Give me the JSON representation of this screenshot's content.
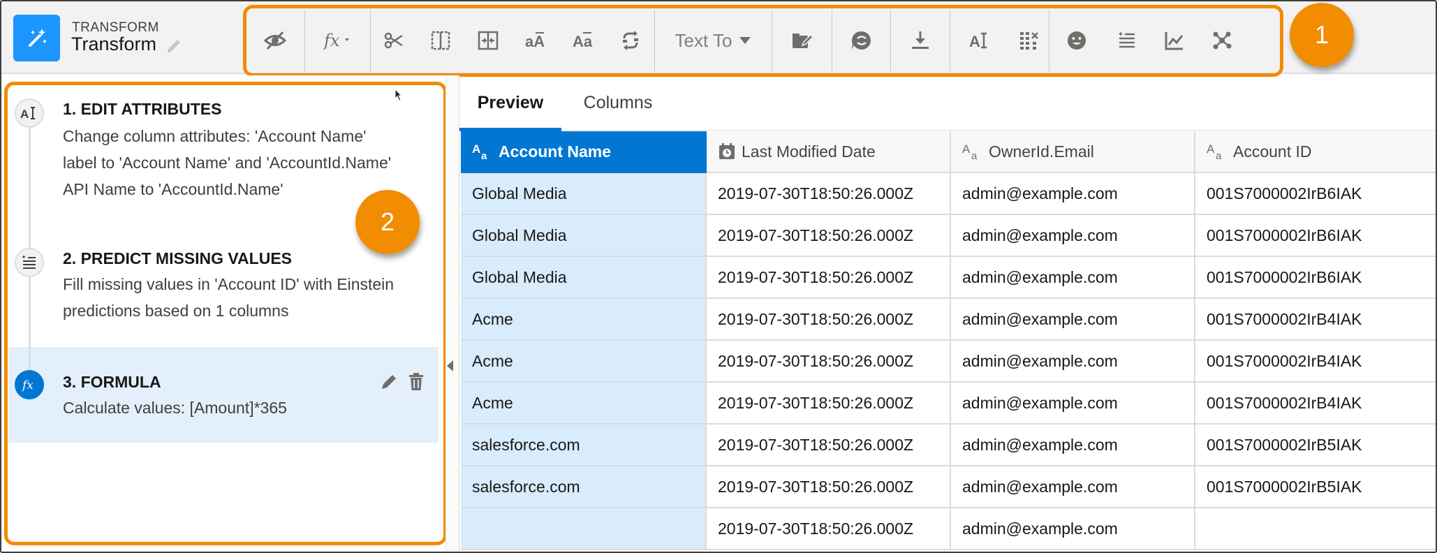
{
  "header": {
    "kicker": "TRANSFORM",
    "title": "Transform"
  },
  "toolbar": {
    "text_to_label": "Text To",
    "icons": [
      "hide-icon",
      "formula-icon",
      "split-icon",
      "bucket-columns-icon",
      "merge-columns-icon",
      "lowercase-icon",
      "uppercase-icon",
      "replace-icon",
      "dropdown-icon",
      "edit-attributes-icon",
      "sentiment-icon",
      "download-icon",
      "text-attributes-icon",
      "drop-columns-icon",
      "emoji-icon",
      "predict-missing-values-icon",
      "time-series-icon",
      "cluster-icon"
    ]
  },
  "badges": {
    "one": "1",
    "two": "2"
  },
  "steps": [
    {
      "title": "1. EDIT ATTRIBUTES",
      "description": "Change column attributes: 'Account Name'\nlabel to 'Account Name' and 'AccountId.Name'\nAPI Name to 'AccountId.Name'",
      "icon": "edit-attributes-icon"
    },
    {
      "title": "2. PREDICT MISSING VALUES",
      "description": "Fill missing values in 'Account ID' with Einstein\npredictions based on 1 columns",
      "icon": "predict-missing-values-icon"
    },
    {
      "title": "3. FORMULA",
      "description": "Calculate values: [Amount]*365",
      "icon": "formula-icon"
    }
  ],
  "tabs": [
    {
      "label": "Preview",
      "active": true
    },
    {
      "label": "Columns",
      "active": false
    }
  ],
  "columns": [
    {
      "label": "Account Name",
      "type_icon": "text-type-icon",
      "selected": true
    },
    {
      "label": "Last Modified Date",
      "type_icon": "date-type-icon",
      "selected": false
    },
    {
      "label": "OwnerId.Email",
      "type_icon": "text-type-icon",
      "selected": false
    },
    {
      "label": "Account ID",
      "type_icon": "text-type-icon",
      "selected": false
    }
  ],
  "rows": [
    [
      "Global Media",
      "2019-07-30T18:50:26.000Z",
      "admin@example.com",
      "001S7000002IrB6IAK"
    ],
    [
      "Global Media",
      "2019-07-30T18:50:26.000Z",
      "admin@example.com",
      "001S7000002IrB6IAK"
    ],
    [
      "Global Media",
      "2019-07-30T18:50:26.000Z",
      "admin@example.com",
      "001S7000002IrB6IAK"
    ],
    [
      "Acme",
      "2019-07-30T18:50:26.000Z",
      "admin@example.com",
      "001S7000002IrB4IAK"
    ],
    [
      "Acme",
      "2019-07-30T18:50:26.000Z",
      "admin@example.com",
      "001S7000002IrB4IAK"
    ],
    [
      "Acme",
      "2019-07-30T18:50:26.000Z",
      "admin@example.com",
      "001S7000002IrB4IAK"
    ],
    [
      "salesforce.com",
      "2019-07-30T18:50:26.000Z",
      "admin@example.com",
      "001S7000002IrB5IAK"
    ],
    [
      "salesforce.com",
      "2019-07-30T18:50:26.000Z",
      "admin@example.com",
      "001S7000002IrB5IAK"
    ],
    [
      "",
      "2019-07-30T18:50:26.000Z",
      "admin@example.com",
      ""
    ]
  ],
  "colors": {
    "accent": "#0176d3",
    "app_icon": "#1b96ff",
    "highlight": "#f38b00",
    "selected_column_cells": "#d8ecfb",
    "active_step": "#e3f0fb"
  }
}
